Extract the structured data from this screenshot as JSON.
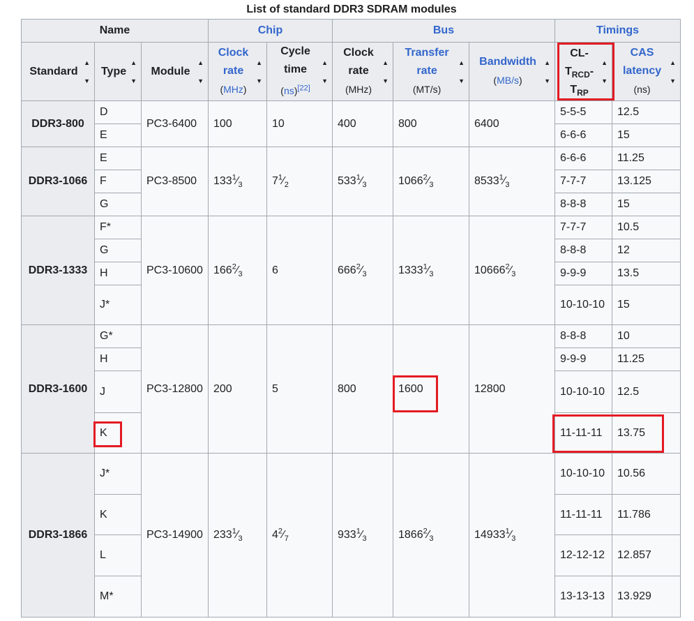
{
  "caption": "List of standard DDR3 SDRAM modules",
  "groups": {
    "name": "Name",
    "chip": "Chip",
    "bus": "Bus",
    "timings": "Timings"
  },
  "columns": {
    "standard": "Standard",
    "type": "Type",
    "module": "Module",
    "chip_clock_1": "Clock",
    "chip_clock_2": "rate",
    "chip_clock_unit": "(MHz)",
    "cycle_1": "Cycle",
    "cycle_2": "time",
    "cycle_unit": "(ns)",
    "cycle_ref": "[22]",
    "bus_clock_1": "Clock",
    "bus_clock_2": "rate",
    "bus_clock_unit": "(MHz)",
    "transfer_1": "Transfer",
    "transfer_2": "rate",
    "transfer_unit": "(MT/s)",
    "bandwidth": "Bandwidth",
    "bandwidth_unit": "(MB/s)",
    "cl_1": "CL-",
    "cl_t1": "T",
    "cl_t1_sub": "RCD",
    "cl_dash": "-",
    "cl_t2": "T",
    "cl_t2_sub": "RP",
    "cas_1": "CAS",
    "cas_2": "latency",
    "cas_unit": "(ns)"
  },
  "rows": [
    {
      "standard": "DDR3-800",
      "module": "PC3-6400",
      "chip_clock": {
        "w": "100"
      },
      "cycle": {
        "w": "10"
      },
      "bus_clock": {
        "w": "400"
      },
      "transfer": {
        "w": "800"
      },
      "bandwidth": {
        "w": "6400"
      },
      "types": [
        {
          "type": "D",
          "timing": "5-5-5",
          "cas": "12.5"
        },
        {
          "type": "E",
          "timing": "6-6-6",
          "cas": "15"
        }
      ]
    },
    {
      "standard": "DDR3-1066",
      "module": "PC3-8500",
      "chip_clock": {
        "w": "133",
        "n": "1",
        "d": "3"
      },
      "cycle": {
        "w": "7",
        "n": "1",
        "d": "2"
      },
      "bus_clock": {
        "w": "533",
        "n": "1",
        "d": "3"
      },
      "transfer": {
        "w": "1066",
        "n": "2",
        "d": "3"
      },
      "bandwidth": {
        "w": "8533",
        "n": "1",
        "d": "3"
      },
      "types": [
        {
          "type": "E",
          "timing": "6-6-6",
          "cas": "11.25"
        },
        {
          "type": "F",
          "timing": "7-7-7",
          "cas": "13.125"
        },
        {
          "type": "G",
          "timing": "8-8-8",
          "cas": "15"
        }
      ]
    },
    {
      "standard": "DDR3-1333",
      "module": "PC3-10600",
      "chip_clock": {
        "w": "166",
        "n": "2",
        "d": "3"
      },
      "cycle": {
        "w": "6"
      },
      "bus_clock": {
        "w": "666",
        "n": "2",
        "d": "3"
      },
      "transfer": {
        "w": "1333",
        "n": "1",
        "d": "3"
      },
      "bandwidth": {
        "w": "10666",
        "n": "2",
        "d": "3"
      },
      "types": [
        {
          "type": "F*",
          "timing": "7-7-7",
          "cas": "10.5"
        },
        {
          "type": "G",
          "timing": "8-8-8",
          "cas": "12"
        },
        {
          "type": "H",
          "timing": "9-9-9",
          "cas": "13.5"
        },
        {
          "type": "J*",
          "timing": "10-10-10",
          "cas": "15"
        }
      ]
    },
    {
      "standard": "DDR3-1600",
      "module": "PC3-12800",
      "chip_clock": {
        "w": "200"
      },
      "cycle": {
        "w": "5"
      },
      "bus_clock": {
        "w": "800"
      },
      "transfer": {
        "w": "1600"
      },
      "bandwidth": {
        "w": "12800"
      },
      "types": [
        {
          "type": "G*",
          "timing": "8-8-8",
          "cas": "10"
        },
        {
          "type": "H",
          "timing": "9-9-9",
          "cas": "11.25"
        },
        {
          "type": "J",
          "timing": "10-10-10",
          "cas": "12.5"
        },
        {
          "type": "K",
          "timing": "11-11-11",
          "cas": "13.75"
        }
      ]
    },
    {
      "standard": "DDR3-1866",
      "module": "PC3-14900",
      "chip_clock": {
        "w": "233",
        "n": "1",
        "d": "3"
      },
      "cycle": {
        "w": "4",
        "n": "2",
        "d": "7"
      },
      "bus_clock": {
        "w": "933",
        "n": "1",
        "d": "3"
      },
      "transfer": {
        "w": "1866",
        "n": "2",
        "d": "3"
      },
      "bandwidth": {
        "w": "14933",
        "n": "1",
        "d": "3"
      },
      "types": [
        {
          "type": "J*",
          "timing": "10-10-10",
          "cas": "10.56"
        },
        {
          "type": "K",
          "timing": "11-11-11",
          "cas": "11.786"
        },
        {
          "type": "L",
          "timing": "12-12-12",
          "cas": "12.857"
        },
        {
          "type": "M*",
          "timing": "13-13-13",
          "cas": "13.929"
        }
      ]
    }
  ],
  "colors": {
    "highlight": "#e31b23",
    "link": "#3366cc",
    "header_bg": "#eaecf0",
    "cell_bg": "#f8f9fa",
    "border": "#a2a9b1"
  }
}
